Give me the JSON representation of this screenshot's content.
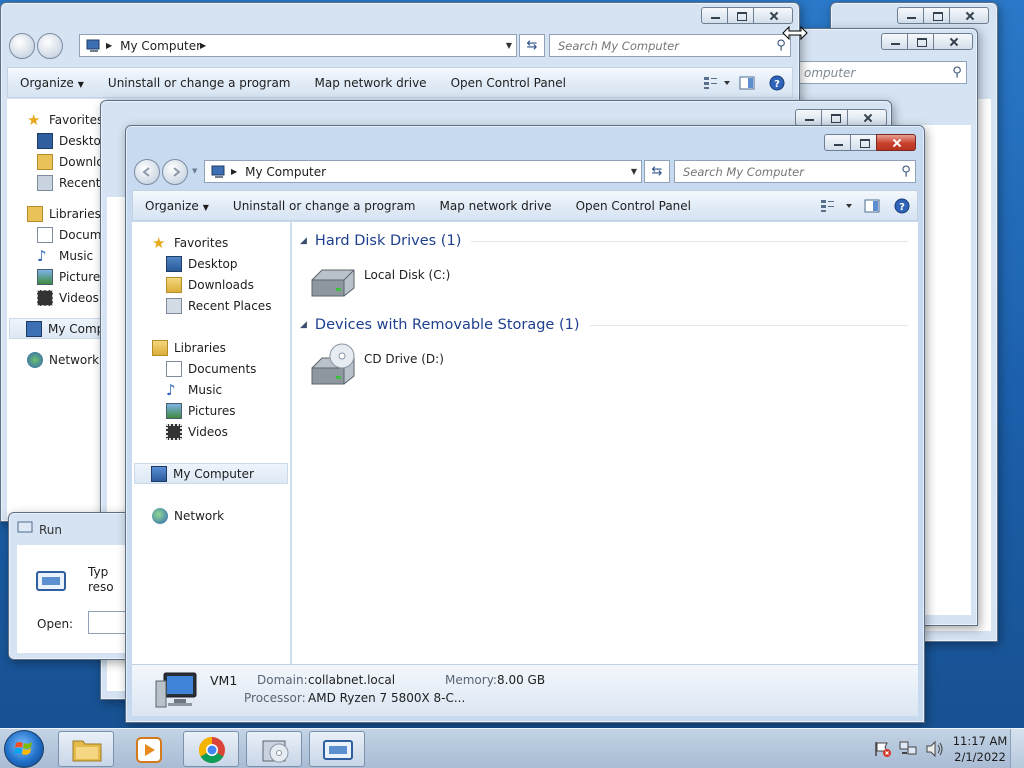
{
  "explorer": {
    "location": "My Computer",
    "search_placeholder": "Search My Computer",
    "commands": {
      "organize": "Organize",
      "uninstall": "Uninstall or change a program",
      "map_drive": "Map network drive",
      "control_panel": "Open Control Panel"
    },
    "nav": {
      "favorites": "Favorites",
      "desktop": "Desktop",
      "downloads": "Downloads",
      "recent": "Recent Places",
      "libraries": "Libraries",
      "documents": "Documents",
      "music": "Music",
      "pictures": "Pictures",
      "videos": "Videos",
      "computer": "My Computer",
      "network": "Network"
    },
    "groups": {
      "hdd": "Hard Disk Drives (1)",
      "removable": "Devices with Removable Storage (1)"
    },
    "drives": {
      "local": "Local Disk (C:)",
      "cd": "CD Drive (D:)"
    },
    "details": {
      "name": "VM1",
      "domain_label": "Domain:",
      "domain": "collabnet.local",
      "memory_label": "Memory:",
      "memory": "8.00 GB",
      "processor_label": "Processor:",
      "processor": "AMD Ryzen 7 5800X 8-C..."
    }
  },
  "back_window": {
    "location": "My Computer",
    "search_placeholder": "Search My Computer",
    "search_partial": "omputer",
    "nav_truncated": {
      "desktop": "Desktop",
      "downloads": "Downlo",
      "recent": "Recent P",
      "documents": "Docume",
      "pictures": "Pictures",
      "computer": "My Comp"
    }
  },
  "run_dialog": {
    "title": "Run",
    "text_line1": "Typ",
    "text_line2": "reso",
    "open_label": "Open:"
  },
  "taskbar": {
    "time": "11:17 AM",
    "date": "2/1/2022"
  },
  "colors": {
    "group_heading": "#1e3f8f",
    "close_button": "#c9412c",
    "desktop_blue": "#1b5ea9"
  }
}
